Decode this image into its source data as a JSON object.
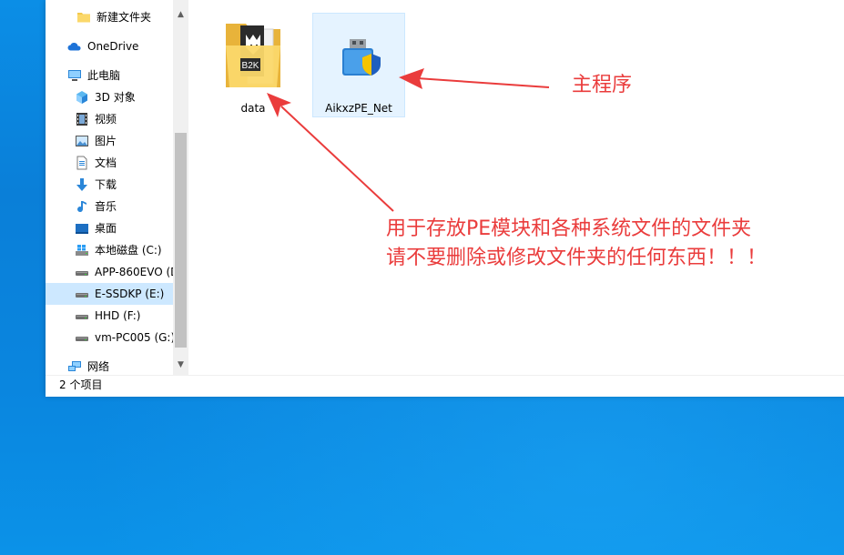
{
  "nav": {
    "items": [
      {
        "label": "新建文件夹",
        "icon": "folder-icon"
      },
      {
        "label": "OneDrive",
        "icon": "cloud-icon"
      },
      {
        "label": "此电脑",
        "icon": "computer-icon"
      },
      {
        "label": "3D 对象",
        "icon": "cube-icon"
      },
      {
        "label": "视频",
        "icon": "video-icon"
      },
      {
        "label": "图片",
        "icon": "picture-icon"
      },
      {
        "label": "文档",
        "icon": "document-icon"
      },
      {
        "label": "下载",
        "icon": "download-icon"
      },
      {
        "label": "音乐",
        "icon": "music-icon"
      },
      {
        "label": "桌面",
        "icon": "desktop-icon"
      },
      {
        "label": "本地磁盘 (C:)",
        "icon": "windows-drive-icon"
      },
      {
        "label": "APP-860EVO (D",
        "icon": "drive-icon"
      },
      {
        "label": "E-SSDKP (E:)",
        "icon": "drive-icon"
      },
      {
        "label": "HHD (F:)",
        "icon": "drive-icon"
      },
      {
        "label": "vm-PC005 (G:)",
        "icon": "drive-icon"
      },
      {
        "label": "网络",
        "icon": "network-icon"
      }
    ],
    "selected_index": 12
  },
  "content": {
    "files": [
      {
        "name": "data",
        "type": "folder",
        "badge": "B2K"
      },
      {
        "name": "AikxzPE_Net",
        "type": "application"
      }
    ]
  },
  "status": {
    "item_count": "2 个项目"
  },
  "annotations": {
    "main_program": "主程序",
    "folder_note_line1": "用于存放PE模块和各种系统文件的文件夹",
    "folder_note_line2": "请不要删除或修改文件夹的任何东西！！！"
  },
  "colors": {
    "annotation_red": "#ea3c3c",
    "selection_blue": "#cde8ff",
    "desktop_blue": "#0a86df"
  }
}
